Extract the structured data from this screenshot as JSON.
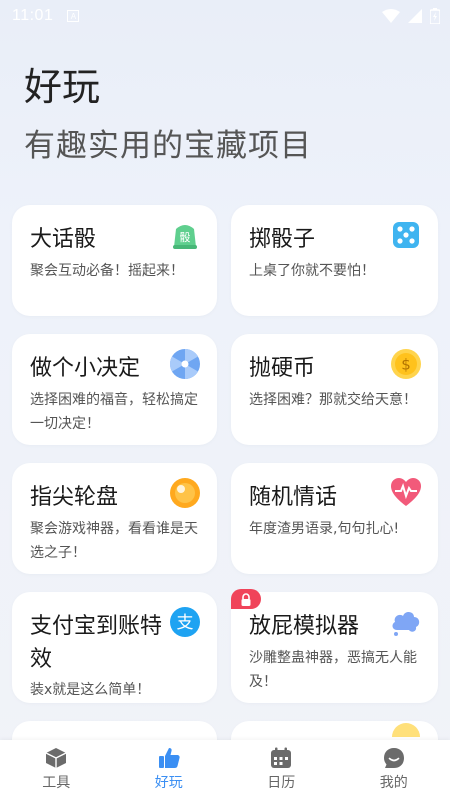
{
  "status": {
    "time": "11:01",
    "a_label": "A"
  },
  "header": {
    "title": "好玩",
    "subtitle": "有趣实用的宝藏项目"
  },
  "cards": [
    {
      "title": "大话骰",
      "desc": "聚会互动必备！摇起来！",
      "icon": "dice-cup-icon",
      "icon_text": "骰"
    },
    {
      "title": "掷骰子",
      "desc": "上桌了你就不要怕！",
      "icon": "dice-icon"
    },
    {
      "title": "做个小决定",
      "desc": "选择困难的福音，轻松搞定一切决定！",
      "icon": "wheel-icon"
    },
    {
      "title": "抛硬币",
      "desc": "选择困难？那就交给天意！",
      "icon": "coin-icon",
      "icon_text": "$"
    },
    {
      "title": "指尖轮盘",
      "desc": "聚会游戏神器，看看谁是天选之子！",
      "icon": "orange-ball-icon"
    },
    {
      "title": "随机情话",
      "desc": "年度渣男语录,句句扎心!",
      "icon": "heart-pulse-icon"
    },
    {
      "title": "支付宝到账特效",
      "desc": "装x就是这么简单！",
      "icon": "alipay-icon",
      "icon_text": "支"
    },
    {
      "title": "放屁模拟器",
      "desc": "沙雕整蛊神器，恶搞无人能及！",
      "icon": "cloud-icon",
      "locked": true
    }
  ],
  "tabs": [
    {
      "label": "工具",
      "icon": "box-icon",
      "active": false
    },
    {
      "label": "好玩",
      "icon": "thumbs-up-icon",
      "active": true
    },
    {
      "label": "日历",
      "icon": "calendar-icon",
      "active": false
    },
    {
      "label": "我的",
      "icon": "face-icon",
      "active": false
    }
  ],
  "colors": {
    "accent": "#3b8ff3",
    "lock": "#f0445a"
  }
}
